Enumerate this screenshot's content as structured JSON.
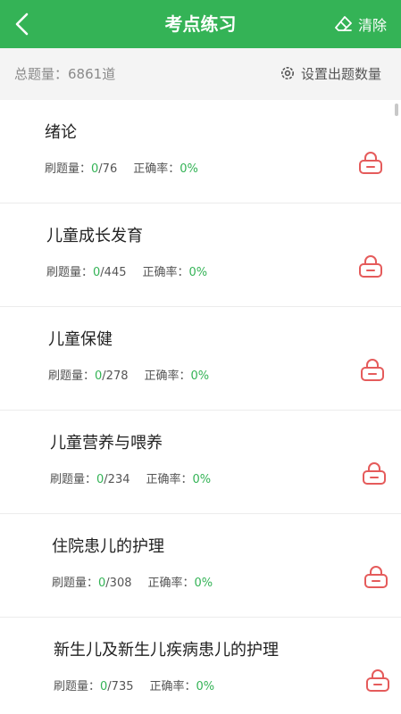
{
  "header": {
    "title": "考点练习",
    "clear_label": "清除"
  },
  "summary": {
    "total_label": "总题量：",
    "total_value": "6861道",
    "settings_label": "设置出题数量"
  },
  "stat_labels": {
    "done": "刷题量：",
    "accuracy": "正确率："
  },
  "items": [
    {
      "title": "绪论",
      "done": "0",
      "total": "/76",
      "accuracy": "0%"
    },
    {
      "title": "儿童成长发育",
      "done": "0",
      "total": "/445",
      "accuracy": "0%"
    },
    {
      "title": "儿童保健",
      "done": "0",
      "total": "/278",
      "accuracy": "0%"
    },
    {
      "title": "儿童营养与喂养",
      "done": "0",
      "total": "/234",
      "accuracy": "0%"
    },
    {
      "title": "住院患儿的护理",
      "done": "0",
      "total": "/308",
      "accuracy": "0%"
    },
    {
      "title": "新生儿及新生儿疾病患儿的护理",
      "done": "0",
      "total": "/735",
      "accuracy": "0%"
    }
  ],
  "colors": {
    "brand": "#34b356",
    "lock": "#e55b5b"
  }
}
